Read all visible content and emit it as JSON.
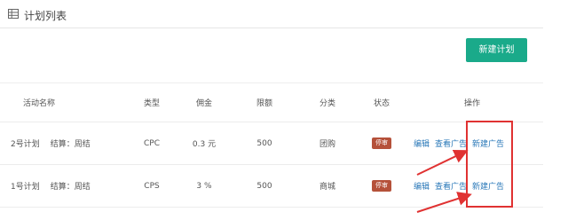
{
  "header": {
    "title": "计划列表",
    "icon": "table-grid-icon"
  },
  "toolbar": {
    "new_plan_label": "新建计划"
  },
  "table": {
    "columns": [
      "活动名称",
      "类型",
      "佣金",
      "限额",
      "分类",
      "状态",
      "操作"
    ],
    "rows": [
      {
        "name": "2号计划",
        "settle": "结算：周结",
        "type": "CPC",
        "commission": "0.3 元",
        "limit": "500",
        "category": "团购",
        "status": "停审",
        "ops": [
          "编辑",
          "查看广告",
          "新建广告"
        ]
      },
      {
        "name": "1号计划",
        "settle": "结算：周结",
        "type": "CPS",
        "commission": "3 %",
        "limit": "500",
        "category": "商城",
        "status": "停审",
        "ops": [
          "编辑",
          "查看广告",
          "新建广告"
        ]
      }
    ]
  },
  "colors": {
    "primary": "#1aaa8a",
    "link": "#2a78b8",
    "badge": "#b5513a",
    "highlight": "#e03232"
  }
}
